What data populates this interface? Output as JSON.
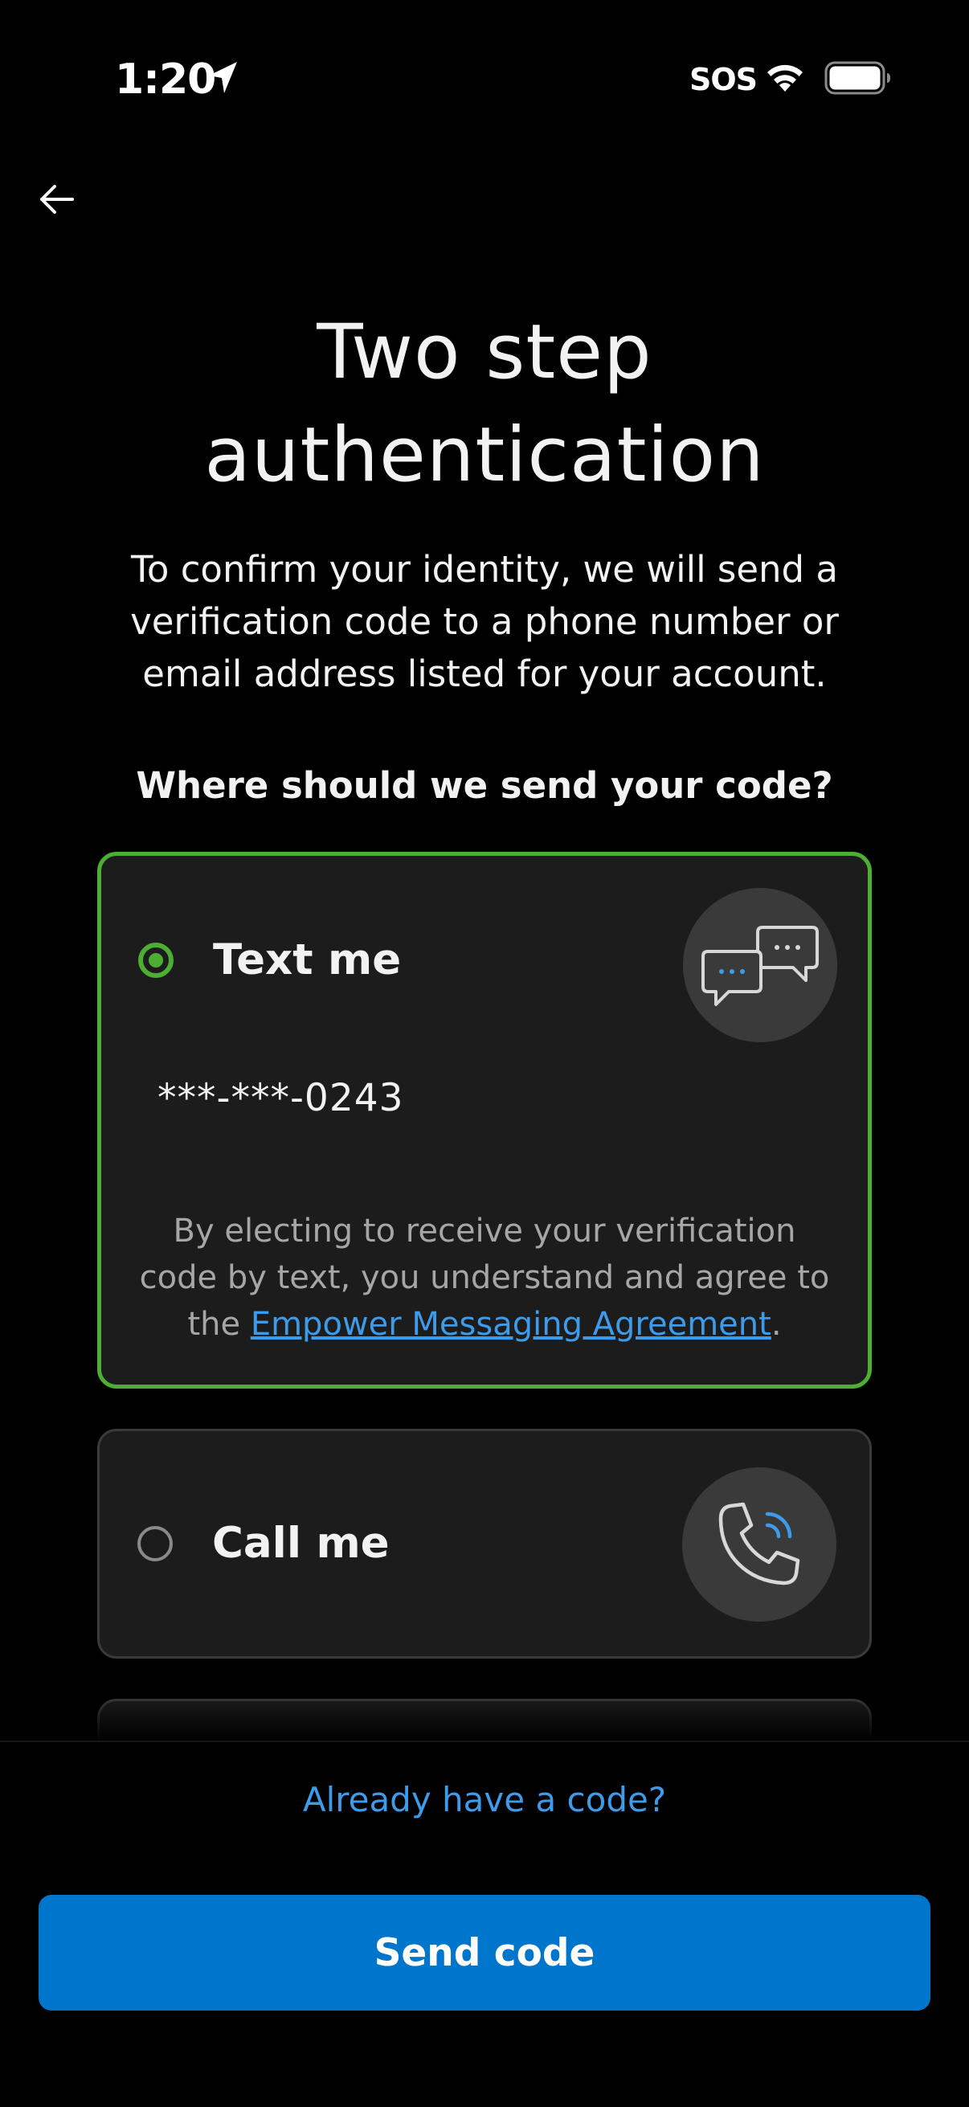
{
  "status_bar": {
    "time": "1:20",
    "sos": "SOS",
    "icons": [
      "location-arrow-icon",
      "wifi-icon",
      "battery-icon"
    ]
  },
  "header": {
    "back_icon": "arrow-left-icon",
    "title_line1": "Two step",
    "title_line2": "authentication",
    "description": "To confirm your identity, we will send a verification code to a phone number or email address listed for your account.",
    "question": "Where should we send your code?"
  },
  "options": [
    {
      "label": "Text me",
      "selected": true,
      "icon": "chat-bubbles-icon",
      "destination": "***-***-0243",
      "consent_prefix": "By electing to receive your verification code by text, you understand and agree to the ",
      "consent_link": "Empower Messaging Agreement",
      "consent_suffix": "."
    },
    {
      "label": "Call me",
      "selected": false,
      "icon": "phone-call-icon"
    }
  ],
  "footer": {
    "already_have_code": "Already have a code?",
    "send_button": "Send code"
  },
  "colors": {
    "background": "#000000",
    "card_background": "#1c1c1c",
    "selected_border": "#4caf32",
    "link": "#3d9be9",
    "primary_button": "#0075cc"
  }
}
